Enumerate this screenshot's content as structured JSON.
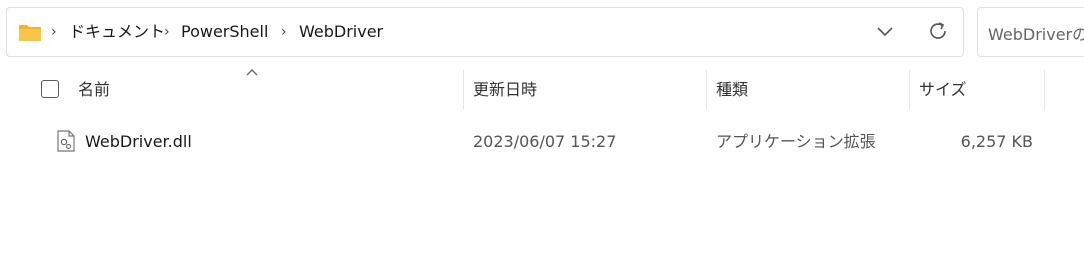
{
  "address_bar": {
    "breadcrumbs": [
      "ドキュメント",
      "PowerShell",
      "WebDriver"
    ],
    "separator": "›"
  },
  "search": {
    "placeholder": "WebDriverの"
  },
  "columns": {
    "name": "名前",
    "date_modified": "更新日時",
    "type": "種類",
    "size": "サイズ",
    "sort_indicator": "ascending (name)"
  },
  "files": [
    {
      "name": "WebDriver.dll",
      "date_modified": "2023/06/07 15:27",
      "type": "アプリケーション拡張",
      "size": "6,257 KB",
      "icon": "dll-file-icon"
    }
  ],
  "colors": {
    "folder_yellow": "#F8C544",
    "border": "#E0E0E0",
    "divider": "#E5E5E5"
  }
}
